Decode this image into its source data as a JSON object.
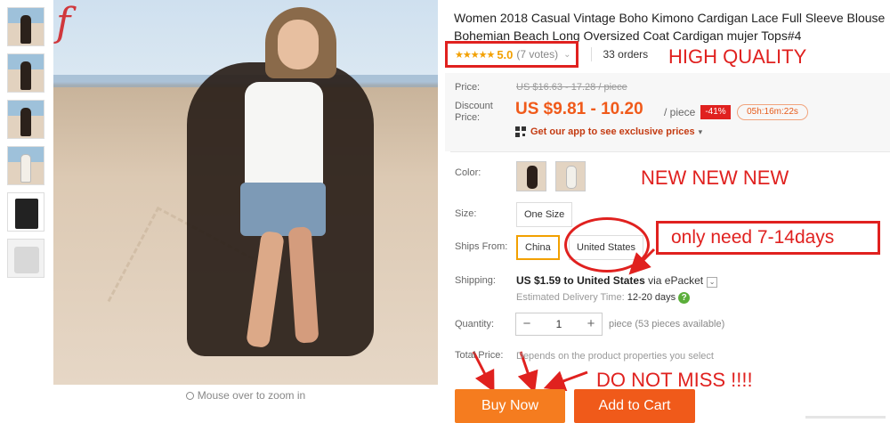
{
  "gallery": {
    "thumbnail_count": 6,
    "zoom_hint": "Mouse over to zoom in",
    "logo_letter": "f"
  },
  "product": {
    "title": "Women 2018 Casual Vintage Boho Kimono Cardigan Lace Full Sleeve Blouse Bohemian Beach Long Oversized Coat Cardigan mujer Tops#4",
    "stars": "★★★★★",
    "rating": "5.0",
    "votes": "(7 votes)",
    "orders": "33 orders"
  },
  "pricing": {
    "price_label": "Price:",
    "original_price": "US $16.63 - 17.28 / piece",
    "discount_label_1": "Discount",
    "discount_label_2": "Price:",
    "discount_price": "US $9.81 - 10.20",
    "per_piece": "/ piece",
    "discount_badge": "-41%",
    "countdown": "05h:16m:22s",
    "app_link": "Get our app to see exclusive prices"
  },
  "options": {
    "color_label": "Color:",
    "size_label": "Size:",
    "size_value": "One Size",
    "ships_from_label": "Ships From:",
    "ships_from": [
      "China",
      "United States"
    ],
    "ships_from_selected": "China"
  },
  "shipping": {
    "label": "Shipping:",
    "cost": "US $1.59",
    "to_word": "to",
    "destination": "United States",
    "via": "via ePacket",
    "delivery_label": "Estimated Delivery Time:",
    "delivery_days": "12-20 days"
  },
  "quantity": {
    "label": "Quantity:",
    "minus": "−",
    "value": "1",
    "plus": "+",
    "note": "piece (53 pieces available)"
  },
  "total": {
    "label": "Total Price:",
    "note": "Depends on the product properties you select"
  },
  "actions": {
    "buy_now": "Buy Now",
    "add_to_cart": "Add to Cart"
  },
  "annotations": {
    "high_quality": "HIGH QUALITY",
    "new": "NEW NEW NEW",
    "ship_days": "only need 7-14days",
    "do_not_miss": "DO NOT MISS !!!!"
  },
  "colors": {
    "accent_orange": "#f05a1a",
    "buy_orange": "#f57c1f",
    "annotation_red": "#e0211f",
    "star_gold": "#f2a000"
  }
}
